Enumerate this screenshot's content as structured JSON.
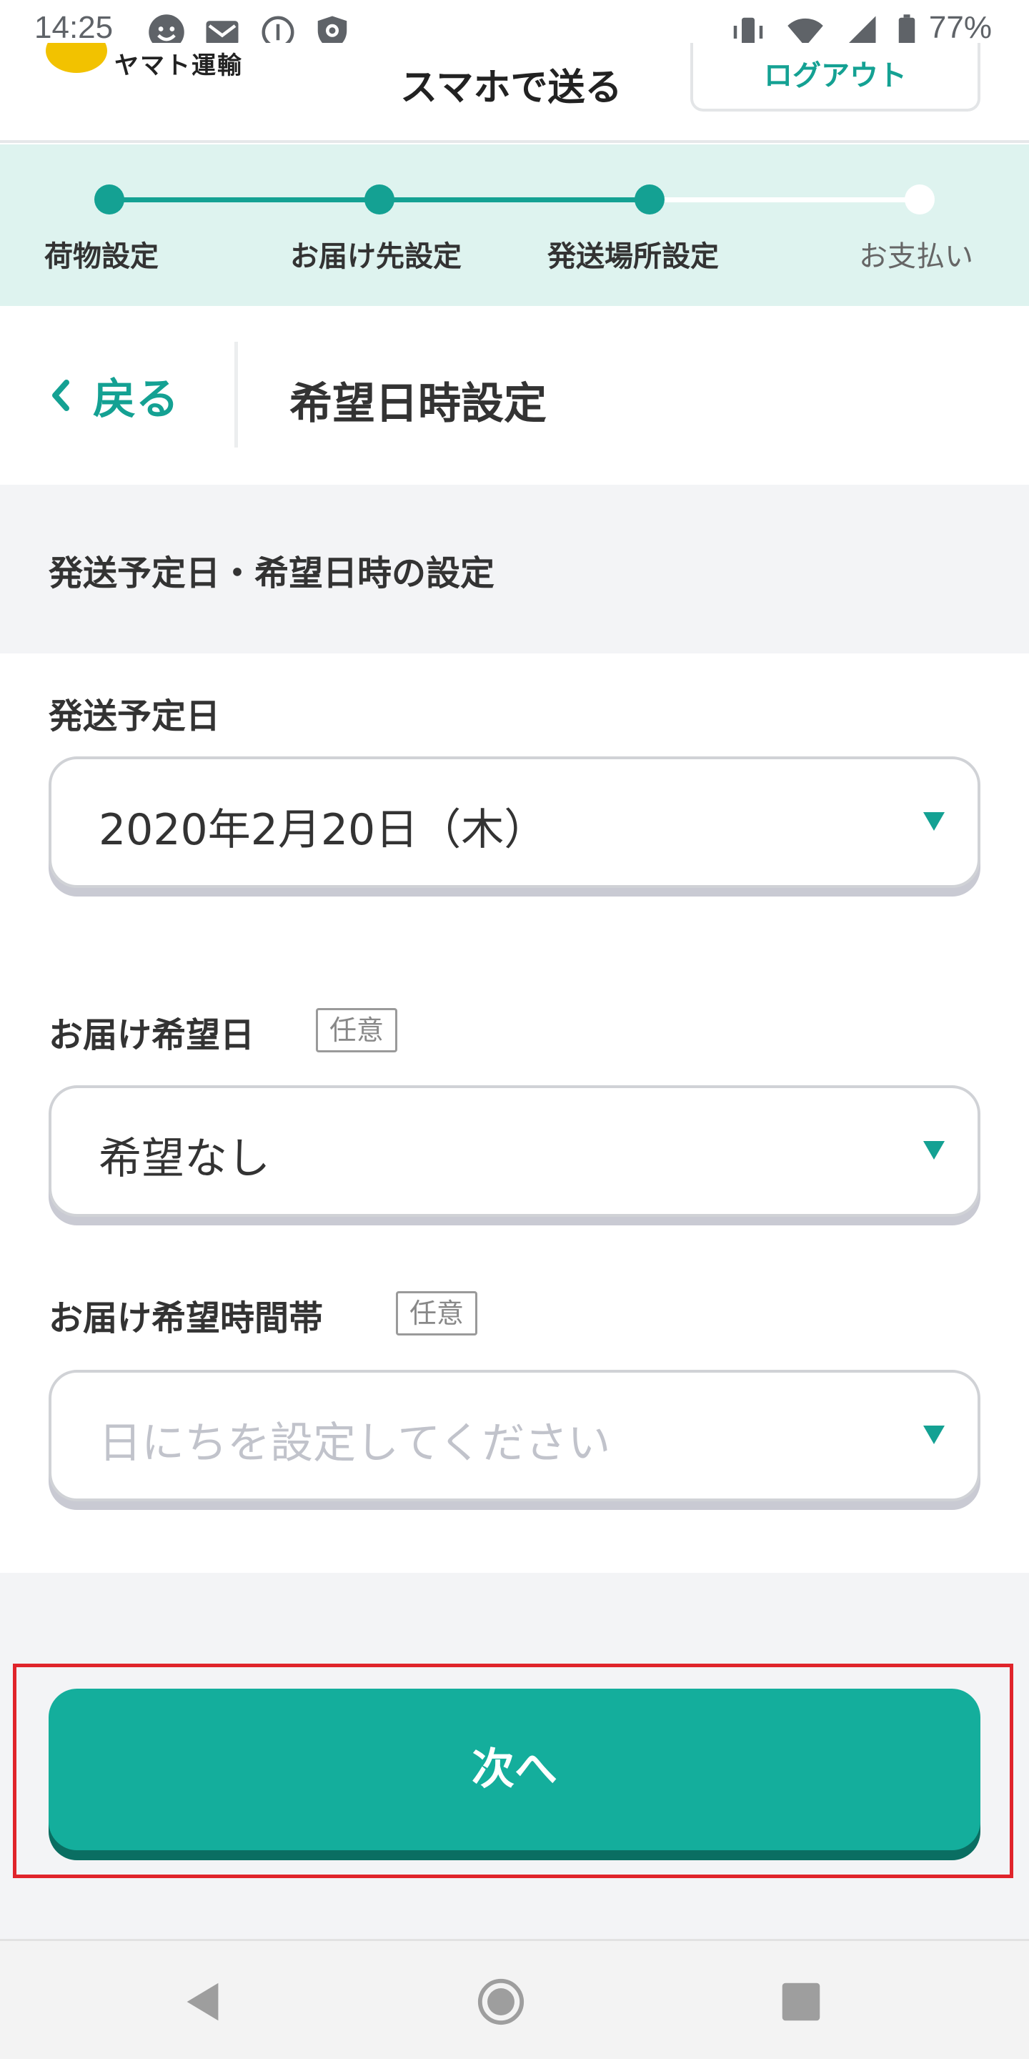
{
  "status_bar": {
    "time": "14:25",
    "battery": "77%",
    "left_icons": [
      "face-icon",
      "mail-icon",
      "info-icon",
      "shield-icon"
    ],
    "right_icons": [
      "vibrate-icon",
      "wifi-icon",
      "signal-icon",
      "battery-icon"
    ]
  },
  "header": {
    "app_title": "スマホで送る",
    "logout_label": "ログアウト",
    "logo_text": "ヤマト運輸"
  },
  "stepper": {
    "steps": [
      {
        "label": "荷物設定",
        "state": "done"
      },
      {
        "label": "お届け先設定",
        "state": "done"
      },
      {
        "label": "発送場所設定",
        "state": "current"
      },
      {
        "label": "お支払い",
        "state": "pending"
      }
    ],
    "accent_color": "#14a193"
  },
  "title_row": {
    "back_label": "戻る",
    "page_title": "希望日時設定"
  },
  "section": {
    "heading": "発送予定日・希望日時の設定"
  },
  "form": {
    "ship_date": {
      "label": "発送予定日",
      "value": "2020年2月20日（木）"
    },
    "delivery_date": {
      "label": "お届け希望日",
      "badge": "任意",
      "value": "希望なし"
    },
    "delivery_time": {
      "label": "お届け希望時間帯",
      "badge": "任意",
      "placeholder": "日にちを設定してください"
    }
  },
  "footer": {
    "next_label": "次へ",
    "button_color": "#14ae9c"
  },
  "navbar": {
    "buttons": [
      "back-nav-icon",
      "home-nav-icon",
      "recents-nav-icon"
    ]
  }
}
